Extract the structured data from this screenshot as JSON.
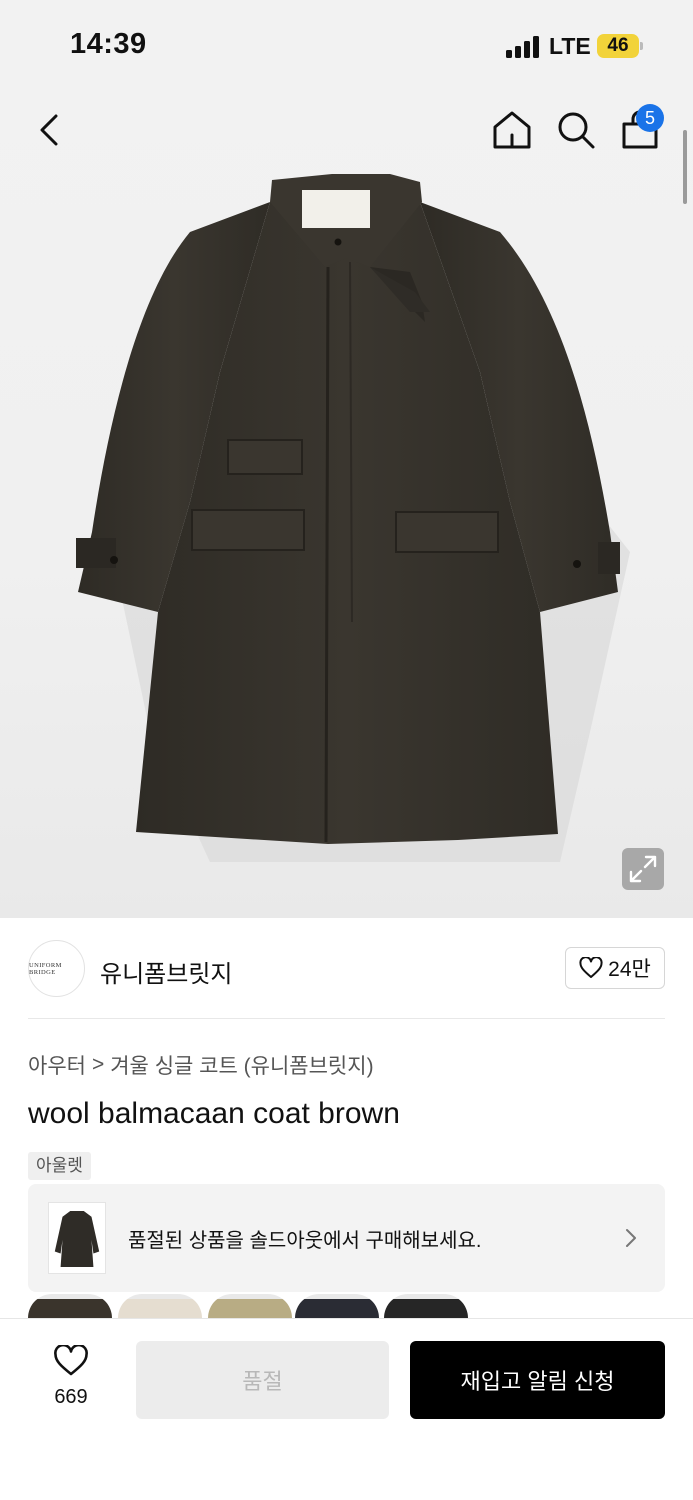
{
  "status_bar": {
    "time": "14:39",
    "network": "LTE",
    "battery": "46"
  },
  "header": {
    "cart_count": "5"
  },
  "icons": {
    "back": "chevron-left-icon",
    "home": "home-icon",
    "search": "search-icon",
    "cart": "shopping-bag-icon",
    "expand": "expand-icon",
    "heart": "heart-icon"
  },
  "brand": {
    "name": "유니폼브릿지",
    "logo_text": "UNIFORM BRIDGE",
    "likes": "24만"
  },
  "breadcrumb": {
    "category": "아우터",
    "separator": ">",
    "subcategory": "겨울 싱글 코트 (유니폼브릿지)"
  },
  "product": {
    "title": "wool balmacaan coat brown",
    "tag": "아울렛"
  },
  "soldout_notice": {
    "text": "품절된 상품을 솔드아웃에서 구매해보세요."
  },
  "swatch_colors": [
    "#3a342c",
    "#e5ddd0",
    "#b8ac84",
    "#2a2c34",
    "#262626"
  ],
  "bottom_bar": {
    "wish_count": "669",
    "soldout_label": "품절",
    "restock_label": "재입고 알림 신청"
  },
  "colors": {
    "accent_badge": "#1a73e8",
    "coat": "#35322b",
    "primary_button": "#000000",
    "disabled_button": "#ececec"
  }
}
